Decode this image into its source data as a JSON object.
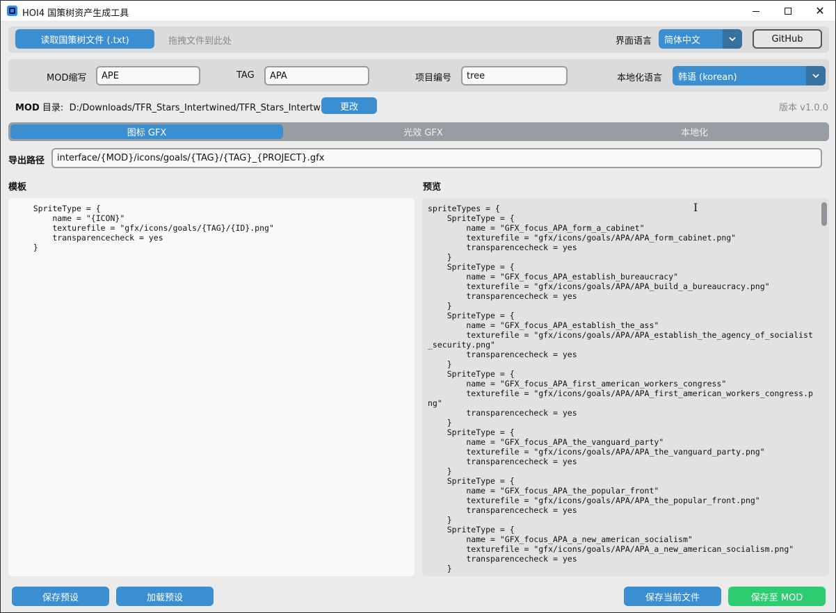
{
  "window": {
    "title": "HOI4 国策树资产生成工具",
    "controls": {
      "minimize": "—",
      "maximize": "□",
      "close": "✕"
    }
  },
  "topbar": {
    "read_button": "读取国策树文件 (.txt)",
    "drop_hint": "拖拽文件到此处",
    "ui_language_label": "界面语言",
    "ui_language_value": "简体中文",
    "github_button": "GitHub"
  },
  "settings": {
    "mod_abbr_label": "MOD缩写",
    "mod_abbr_value": "APE",
    "tag_label": "TAG",
    "tag_value": "APA",
    "project_label": "项目编号",
    "project_value": "tree",
    "localization_label": "本地化语言",
    "localization_value": "韩语 (korean)"
  },
  "moddir": {
    "label_bold": "MOD",
    "label_rest": " 目录:",
    "path": "D:/Downloads/TFR_Stars_Intertwined/TFR_Stars_Intertwined",
    "change_button": "更改",
    "version": "版本 v1.0.0"
  },
  "tabs": [
    {
      "label": "图标 GFX",
      "active": true
    },
    {
      "label": "光效 GFX",
      "active": false
    },
    {
      "label": "本地化",
      "active": false
    }
  ],
  "export": {
    "label": "导出路径",
    "value": "interface/{MOD}/icons/goals/{TAG}/{TAG}_{PROJECT}.gfx"
  },
  "template": {
    "label": "模板",
    "text": "    SpriteType = {\n        name = \"{ICON}\"\n        texturefile = \"gfx/icons/goals/{TAG}/{ID}.png\"\n        transparencecheck = yes\n    }"
  },
  "preview": {
    "label": "预览",
    "text": "spriteTypes = {\n    SpriteType = {\n        name = \"GFX_focus_APA_form_a_cabinet\"\n        texturefile = \"gfx/icons/goals/APA/APA_form_cabinet.png\"\n        transparencecheck = yes\n    }\n    SpriteType = {\n        name = \"GFX_focus_APA_establish_bureaucracy\"\n        texturefile = \"gfx/icons/goals/APA/APA_build_a_bureaucracy.png\"\n        transparencecheck = yes\n    }\n    SpriteType = {\n        name = \"GFX_focus_APA_establish_the_ass\"\n        texturefile = \"gfx/icons/goals/APA/APA_establish_the_agency_of_socialist\n_security.png\"\n        transparencecheck = yes\n    }\n    SpriteType = {\n        name = \"GFX_focus_APA_first_american_workers_congress\"\n        texturefile = \"gfx/icons/goals/APA/APA_first_american_workers_congress.p\nng\"\n        transparencecheck = yes\n    }\n    SpriteType = {\n        name = \"GFX_focus_APA_the_vanguard_party\"\n        texturefile = \"gfx/icons/goals/APA/APA_the_vanguard_party.png\"\n        transparencecheck = yes\n    }\n    SpriteType = {\n        name = \"GFX_focus_APA_the_popular_front\"\n        texturefile = \"gfx/icons/goals/APA/APA_the_popular_front.png\"\n        transparencecheck = yes\n    }\n    SpriteType = {\n        name = \"GFX_focus_APA_a_new_american_socialism\"\n        texturefile = \"gfx/icons/goals/APA/APA_a_new_american_socialism.png\"\n        transparencecheck = yes\n    }"
  },
  "bottom": {
    "save_preset": "保存预设",
    "load_preset": "加载预设",
    "save_current_file": "保存当前文件",
    "save_to_mod": "保存至 MOD"
  },
  "colors": {
    "accent": "#3b8ed0",
    "accent_dark": "#36719f",
    "success": "#2ecc71",
    "tab_bar": "#979da2"
  },
  "icons": {
    "app": "app-icon",
    "dropdown": "chevron-down-icon",
    "cursor": "text-cursor-icon"
  }
}
